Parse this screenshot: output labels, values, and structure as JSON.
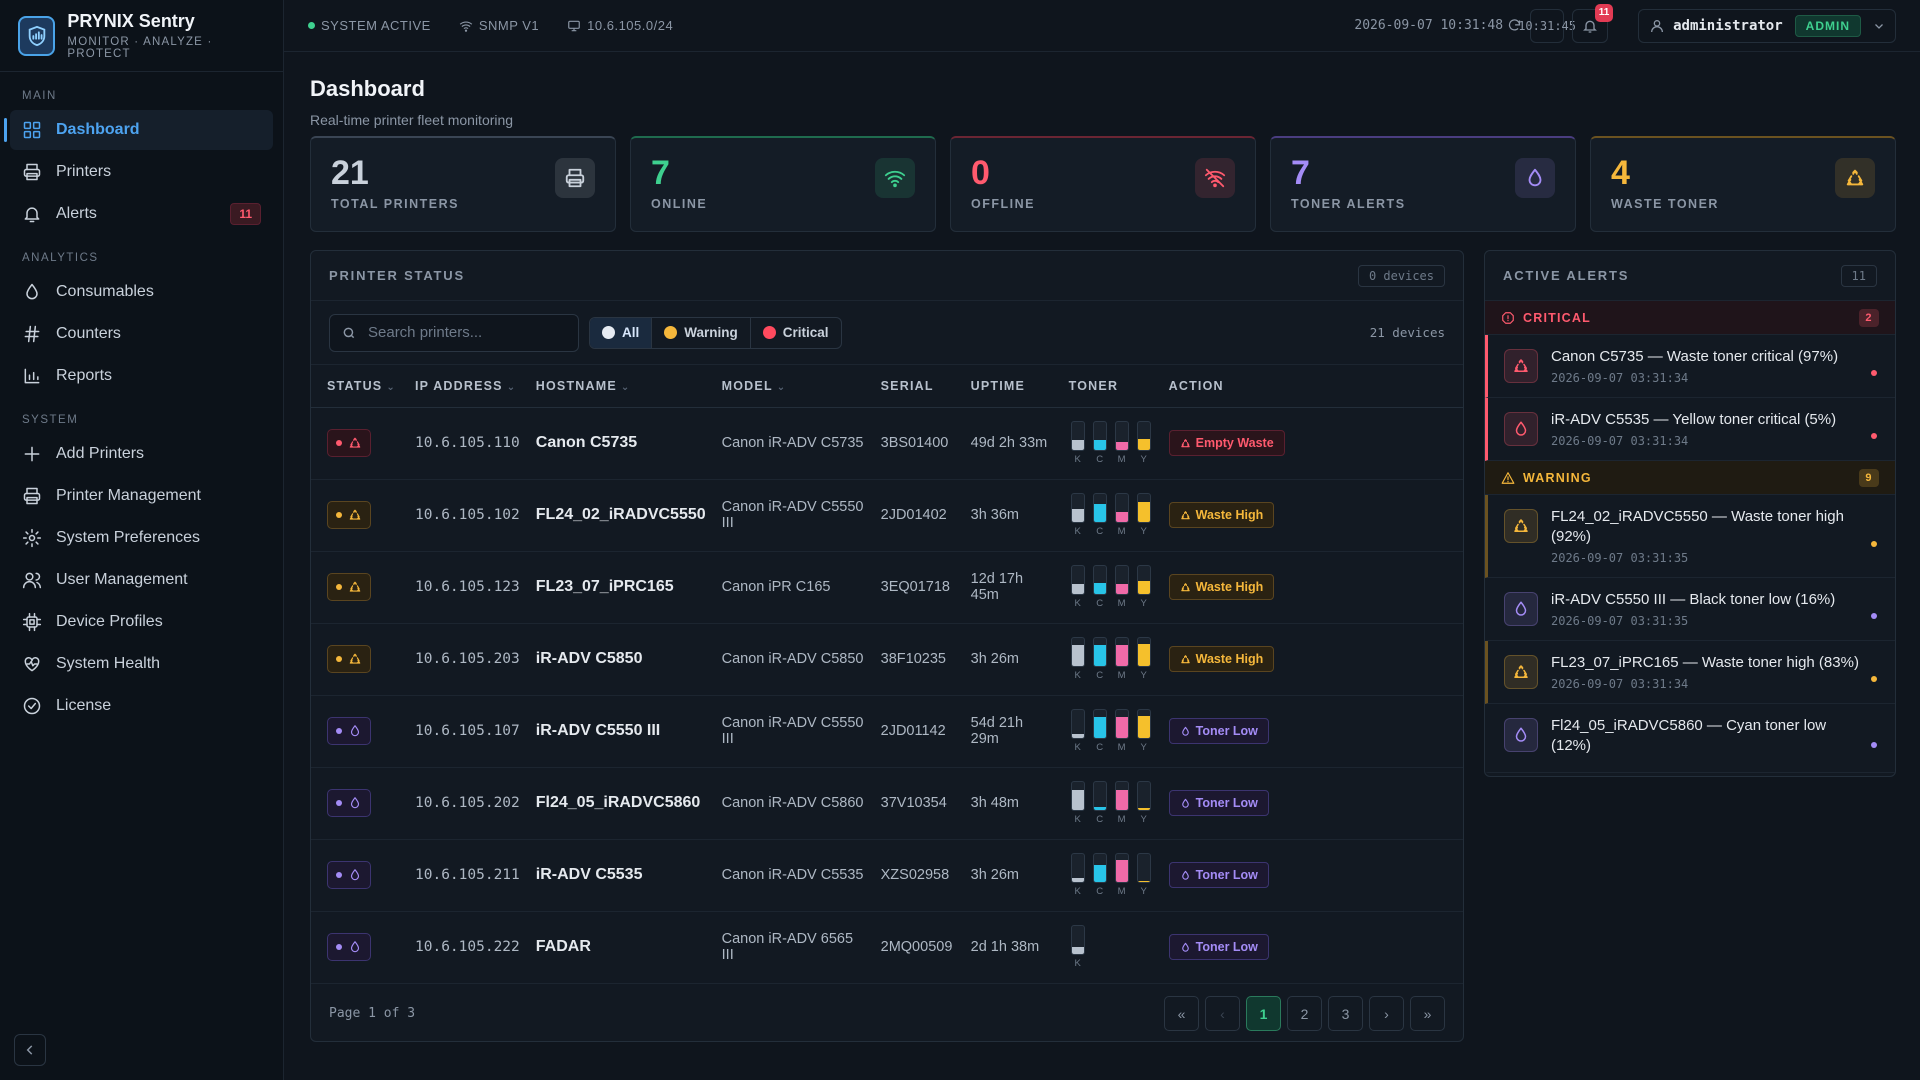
{
  "brand": {
    "name": "PRYNIX",
    "name2": "Sentry",
    "tagline": "MONITOR · ANALYZE · PROTECT"
  },
  "sidebar": {
    "sections": [
      {
        "title": "MAIN",
        "items": [
          {
            "label": "Dashboard",
            "icon": "grid-icon",
            "active": true
          },
          {
            "label": "Printers",
            "icon": "printer-icon"
          },
          {
            "label": "Alerts",
            "icon": "bell-icon",
            "badge": "11"
          }
        ]
      },
      {
        "title": "ANALYTICS",
        "items": [
          {
            "label": "Consumables",
            "icon": "drop-icon"
          },
          {
            "label": "Counters",
            "icon": "hash-icon"
          },
          {
            "label": "Reports",
            "icon": "bar-chart-icon"
          }
        ]
      },
      {
        "title": "SYSTEM",
        "items": [
          {
            "label": "Add Printers",
            "icon": "plus-icon"
          },
          {
            "label": "Printer Management",
            "icon": "printer-icon"
          },
          {
            "label": "System Preferences",
            "icon": "gear-icon"
          },
          {
            "label": "User Management",
            "icon": "users-icon"
          },
          {
            "label": "Device Profiles",
            "icon": "chip-icon"
          },
          {
            "label": "System Health",
            "icon": "heart-pulse-icon"
          },
          {
            "label": "License",
            "icon": "check-circle-icon"
          }
        ]
      }
    ]
  },
  "topbar": {
    "status": "SYSTEM ACTIVE",
    "snmp": "SNMP V1",
    "subnet": "10.6.105.0/24",
    "datetime": "2026-09-07 10:31:48",
    "refresh_time": "10:31:45",
    "notif_count": "11",
    "user": "administrator",
    "role": "ADMIN"
  },
  "page": {
    "title": "Dashboard",
    "subtitle": "Real-time printer fleet monitoring"
  },
  "stats": [
    {
      "value": "21",
      "label": "TOTAL PRINTERS",
      "color": "#c9d1db",
      "accent": "#3a4554",
      "icon": "printer-icon"
    },
    {
      "value": "7",
      "label": "ONLINE",
      "color": "#3ed08f",
      "accent": "#1f6b4e",
      "icon": "wifi-icon"
    },
    {
      "value": "0",
      "label": "OFFLINE",
      "color": "#ff5a6e",
      "accent": "#6b2533",
      "icon": "wifi-off-icon"
    },
    {
      "value": "7",
      "label": "TONER ALERTS",
      "color": "#a48cf6",
      "accent": "#4a3d80",
      "icon": "drop-icon"
    },
    {
      "value": "4",
      "label": "WASTE TONER",
      "color": "#f5b73b",
      "accent": "#6b5220",
      "icon": "recycle-icon"
    }
  ],
  "printer_panel": {
    "title": "PRINTER STATUS",
    "count_badge": "0 devices",
    "search_placeholder": "Search printers...",
    "filters": [
      "All",
      "Warning",
      "Critical"
    ],
    "device_count": "21 devices",
    "columns": [
      "STATUS",
      "IP ADDRESS",
      "HOSTNAME",
      "MODEL",
      "SERIAL",
      "UPTIME",
      "TONER",
      "ACTION"
    ],
    "toner_labels": [
      "K",
      "C",
      "M",
      "Y"
    ],
    "rows": [
      {
        "severity": "critical",
        "kind": "waste",
        "ip": "10.6.105.110",
        "host": "Canon C5735",
        "model": "Canon iR-ADV C5735",
        "serial": "3BS01400",
        "uptime": "49d 2h 33m",
        "toner": [
          0.35,
          0.35,
          0.3,
          0.4
        ],
        "action": "Empty Waste"
      },
      {
        "severity": "warning",
        "kind": "waste",
        "ip": "10.6.105.102",
        "host": "FL24_02_iRADVC5550",
        "model": "Canon iR-ADV C5550 III",
        "serial": "2JD01402",
        "uptime": "3h 36m",
        "toner": [
          0.45,
          0.65,
          0.35,
          0.7
        ],
        "action": "Waste High"
      },
      {
        "severity": "warning",
        "kind": "waste",
        "ip": "10.6.105.123",
        "host": "FL23_07_iPRC165",
        "model": "Canon iPR C165",
        "serial": "3EQ01718",
        "uptime": "12d 17h 45m",
        "toner": [
          0.35,
          0.4,
          0.35,
          0.45
        ],
        "action": "Waste High"
      },
      {
        "severity": "warning",
        "kind": "waste",
        "ip": "10.6.105.203",
        "host": "iR-ADV C5850",
        "model": "Canon iR-ADV C5850",
        "serial": "38F10235",
        "uptime": "3h 26m",
        "toner": [
          0.75,
          0.75,
          0.75,
          0.8
        ],
        "action": "Waste High"
      },
      {
        "severity": "toner",
        "kind": "toner",
        "ip": "10.6.105.107",
        "host": "iR-ADV C5550 III",
        "model": "Canon iR-ADV C5550 III",
        "serial": "2JD01142",
        "uptime": "54d 21h 29m",
        "toner": [
          0.16,
          0.75,
          0.75,
          0.8
        ],
        "action": "Toner Low"
      },
      {
        "severity": "toner",
        "kind": "toner",
        "ip": "10.6.105.202",
        "host": "Fl24_05_iRADVC5860",
        "model": "Canon iR-ADV C5860",
        "serial": "37V10354",
        "uptime": "3h 48m",
        "toner": [
          0.7,
          0.12,
          0.7,
          0.08
        ],
        "action": "Toner Low"
      },
      {
        "severity": "toner",
        "kind": "toner",
        "ip": "10.6.105.211",
        "host": "iR-ADV C5535",
        "model": "Canon iR-ADV C5535",
        "serial": "XZS02958",
        "uptime": "3h 26m",
        "toner": [
          0.15,
          0.6,
          0.8,
          0.05
        ],
        "action": "Toner Low"
      },
      {
        "severity": "toner",
        "kind": "toner",
        "ip": "10.6.105.222",
        "host": "FADAR",
        "model": "Canon iR-ADV 6565 III",
        "serial": "2MQ00509",
        "uptime": "2d 1h 38m",
        "toner": [
          0.25
        ],
        "action": "Toner Low"
      }
    ],
    "page_info": "Page 1 of 3",
    "pages": [
      "«",
      "‹",
      "1",
      "2",
      "3",
      "›",
      "»"
    ]
  },
  "alerts_panel": {
    "title": "ACTIVE ALERTS",
    "count": "11",
    "groups": [
      {
        "name": "CRITICAL",
        "count": "2",
        "color": "#ff5a6e",
        "items": [
          {
            "text": "Canon C5735 — Waste toner critical (97%)",
            "time": "2026-09-07 03:31:34",
            "icon": "recycle-icon"
          },
          {
            "text": "iR-ADV C5535 — Yellow toner critical (5%)",
            "time": "2026-09-07 03:31:34",
            "icon": "drop-icon"
          }
        ]
      },
      {
        "name": "WARNING",
        "count": "9",
        "color": "#f5b73b",
        "items": [
          {
            "text": "FL24_02_iRADVC5550 — Waste toner high (92%)",
            "time": "2026-09-07 03:31:35",
            "icon": "recycle-icon",
            "tone": "waste"
          },
          {
            "text": "iR-ADV C5550 III — Black toner low (16%)",
            "time": "2026-09-07 03:31:35",
            "icon": "drop-icon",
            "tone": "toner"
          },
          {
            "text": "FL23_07_iPRC165 — Waste toner high (83%)",
            "time": "2026-09-07 03:31:34",
            "icon": "recycle-icon",
            "tone": "waste"
          },
          {
            "text": "Fl24_05_iRADVC5860 — Cyan toner low (12%)",
            "time": "",
            "icon": "drop-icon",
            "tone": "toner"
          }
        ]
      }
    ]
  },
  "colors": {
    "critical": "#ff5a6e",
    "warning": "#f5b73b",
    "toner": "#a48cf6",
    "online": "#3ed08f",
    "accent": "#4da3f0",
    "toner_K": "#b8c2ce",
    "toner_C": "#28c4e8",
    "toner_M": "#f06aa8",
    "toner_Y": "#f5c02c"
  }
}
